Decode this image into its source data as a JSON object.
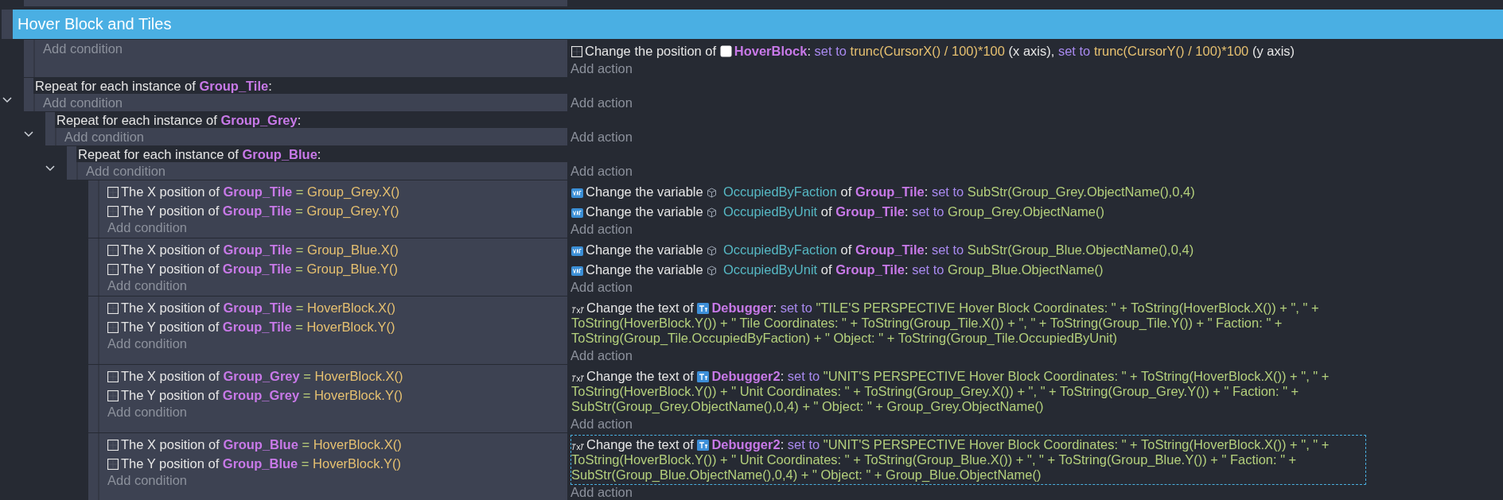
{
  "group": {
    "title": "Hover Block and Tiles"
  },
  "events": [
    {
      "kind": "standard",
      "add_condition": "Add condition",
      "add_action": "Add action",
      "actions": [
        {
          "kind": "position",
          "selected": false,
          "parts": [
            {
              "kind": "text",
              "text": "Change the position of"
            },
            {
              "kind": "sprite_object",
              "text": "HoverBlock"
            },
            {
              "kind": "text",
              "text": ":"
            },
            {
              "kind": "keyword",
              "text": "set to"
            },
            {
              "kind": "number",
              "text": "trunc(CursorX() / 100)*100"
            },
            {
              "kind": "text",
              "text": "(x axis),"
            },
            {
              "kind": "keyword",
              "text": "set to"
            },
            {
              "kind": "number",
              "text": "trunc(CursorY() / 100)*100"
            },
            {
              "kind": "text",
              "text": "(y axis)"
            }
          ]
        }
      ]
    },
    {
      "kind": "repeat",
      "expanded": true,
      "title": [
        {
          "kind": "text",
          "text": "Repeat for each instance of"
        },
        {
          "kind": "object",
          "text": "Group_Tile"
        },
        {
          "kind": "text",
          "text": ":"
        }
      ],
      "add_condition": "Add condition",
      "add_action": "Add action",
      "children": [
        {
          "kind": "repeat",
          "expanded": true,
          "title": [
            {
              "kind": "text",
              "text": "Repeat for each instance of"
            },
            {
              "kind": "object",
              "text": "Group_Grey"
            },
            {
              "kind": "text",
              "text": ":"
            }
          ],
          "add_condition": "Add condition",
          "add_action": "Add action",
          "children": [
            {
              "kind": "repeat",
              "expanded": true,
              "title": [
                {
                  "kind": "text",
                  "text": "Repeat for each instance of"
                },
                {
                  "kind": "object",
                  "text": "Group_Blue"
                },
                {
                  "kind": "text",
                  "text": ":"
                }
              ],
              "add_condition": "Add condition",
              "add_action": "Add action",
              "children": [
                {
                  "kind": "standard",
                  "add_condition": "Add condition",
                  "add_action": "Add action",
                  "conditions": [
                    {
                      "kind": "compare",
                      "parts": [
                        {
                          "kind": "text",
                          "text": "The X position of"
                        },
                        {
                          "kind": "object",
                          "text": "Group_Tile"
                        },
                        {
                          "kind": "operator",
                          "text": "="
                        },
                        {
                          "kind": "number",
                          "text": "Group_Grey.X()"
                        }
                      ]
                    },
                    {
                      "kind": "compare",
                      "parts": [
                        {
                          "kind": "text",
                          "text": "The Y position of"
                        },
                        {
                          "kind": "object",
                          "text": "Group_Tile"
                        },
                        {
                          "kind": "operator",
                          "text": "="
                        },
                        {
                          "kind": "number",
                          "text": "Group_Grey.Y()"
                        }
                      ]
                    }
                  ],
                  "actions": [
                    {
                      "kind": "variable",
                      "selected": false,
                      "parts": [
                        {
                          "kind": "text",
                          "text": "Change the variable"
                        },
                        {
                          "kind": "variable",
                          "text": "OccupiedByFaction"
                        },
                        {
                          "kind": "text",
                          "text": "of"
                        },
                        {
                          "kind": "object",
                          "text": "Group_Tile"
                        },
                        {
                          "kind": "text",
                          "text": ":"
                        },
                        {
                          "kind": "keyword",
                          "text": "set to"
                        },
                        {
                          "kind": "string",
                          "text": "SubStr(Group_Grey.ObjectName(),0,4)"
                        }
                      ]
                    },
                    {
                      "kind": "variable",
                      "selected": false,
                      "parts": [
                        {
                          "kind": "text",
                          "text": "Change the variable"
                        },
                        {
                          "kind": "variable",
                          "text": "OccupiedByUnit"
                        },
                        {
                          "kind": "text",
                          "text": "of"
                        },
                        {
                          "kind": "object",
                          "text": "Group_Tile"
                        },
                        {
                          "kind": "text",
                          "text": ":"
                        },
                        {
                          "kind": "keyword",
                          "text": "set to"
                        },
                        {
                          "kind": "string",
                          "text": "Group_Grey.ObjectName()"
                        }
                      ]
                    }
                  ]
                },
                {
                  "kind": "standard",
                  "add_condition": "Add condition",
                  "add_action": "Add action",
                  "conditions": [
                    {
                      "kind": "compare",
                      "parts": [
                        {
                          "kind": "text",
                          "text": "The X position of"
                        },
                        {
                          "kind": "object",
                          "text": "Group_Tile"
                        },
                        {
                          "kind": "operator",
                          "text": "="
                        },
                        {
                          "kind": "number",
                          "text": "Group_Blue.X()"
                        }
                      ]
                    },
                    {
                      "kind": "compare",
                      "parts": [
                        {
                          "kind": "text",
                          "text": "The Y position of"
                        },
                        {
                          "kind": "object",
                          "text": "Group_Tile"
                        },
                        {
                          "kind": "operator",
                          "text": "="
                        },
                        {
                          "kind": "number",
                          "text": "Group_Blue.Y()"
                        }
                      ]
                    }
                  ],
                  "actions": [
                    {
                      "kind": "variable",
                      "selected": false,
                      "parts": [
                        {
                          "kind": "text",
                          "text": "Change the variable"
                        },
                        {
                          "kind": "variable",
                          "text": "OccupiedByFaction"
                        },
                        {
                          "kind": "text",
                          "text": "of"
                        },
                        {
                          "kind": "object",
                          "text": "Group_Tile"
                        },
                        {
                          "kind": "text",
                          "text": ":"
                        },
                        {
                          "kind": "keyword",
                          "text": "set to"
                        },
                        {
                          "kind": "string",
                          "text": "SubStr(Group_Blue.ObjectName(),0,4)"
                        }
                      ]
                    },
                    {
                      "kind": "variable",
                      "selected": false,
                      "parts": [
                        {
                          "kind": "text",
                          "text": "Change the variable"
                        },
                        {
                          "kind": "variable",
                          "text": "OccupiedByUnit"
                        },
                        {
                          "kind": "text",
                          "text": "of"
                        },
                        {
                          "kind": "object",
                          "text": "Group_Tile"
                        },
                        {
                          "kind": "text",
                          "text": ":"
                        },
                        {
                          "kind": "keyword",
                          "text": "set to"
                        },
                        {
                          "kind": "string",
                          "text": "Group_Blue.ObjectName()"
                        }
                      ]
                    }
                  ]
                },
                {
                  "kind": "standard",
                  "add_condition": "Add condition",
                  "add_action": "Add action",
                  "conditions": [
                    {
                      "kind": "compare",
                      "parts": [
                        {
                          "kind": "text",
                          "text": "The X position of"
                        },
                        {
                          "kind": "object",
                          "text": "Group_Tile"
                        },
                        {
                          "kind": "operator",
                          "text": "="
                        },
                        {
                          "kind": "number",
                          "text": "HoverBlock.X()"
                        }
                      ]
                    },
                    {
                      "kind": "compare",
                      "parts": [
                        {
                          "kind": "text",
                          "text": "The Y position of"
                        },
                        {
                          "kind": "object",
                          "text": "Group_Tile"
                        },
                        {
                          "kind": "operator",
                          "text": "="
                        },
                        {
                          "kind": "number",
                          "text": "HoverBlock.Y()"
                        }
                      ]
                    }
                  ],
                  "actions": [
                    {
                      "kind": "text",
                      "selected": false,
                      "parts": [
                        {
                          "kind": "text",
                          "text": "Change the text of"
                        },
                        {
                          "kind": "text_object",
                          "text": "Debugger"
                        },
                        {
                          "kind": "text",
                          "text": ":"
                        },
                        {
                          "kind": "keyword",
                          "text": "set to"
                        },
                        {
                          "kind": "string",
                          "text": "\"TILE'S PERSPECTIVE Hover Block Coordinates: \" + ToString(HoverBlock.X()) + \", \" + ToString(HoverBlock.Y()) + \" Tile Coordinates: \" + ToString(Group_Tile.X()) + \", \" + ToString(Group_Tile.Y()) + \" Faction: \" + ToString(Group_Tile.OccupiedByFaction) + \" Object: \" + ToString(Group_Tile.OccupiedByUnit)"
                        }
                      ]
                    }
                  ]
                },
                {
                  "kind": "standard",
                  "add_condition": "Add condition",
                  "add_action": "Add action",
                  "conditions": [
                    {
                      "kind": "compare",
                      "parts": [
                        {
                          "kind": "text",
                          "text": "The X position of"
                        },
                        {
                          "kind": "object",
                          "text": "Group_Grey"
                        },
                        {
                          "kind": "operator",
                          "text": "="
                        },
                        {
                          "kind": "number",
                          "text": "HoverBlock.X()"
                        }
                      ]
                    },
                    {
                      "kind": "compare",
                      "parts": [
                        {
                          "kind": "text",
                          "text": "The Y position of"
                        },
                        {
                          "kind": "object",
                          "text": "Group_Grey"
                        },
                        {
                          "kind": "operator",
                          "text": "="
                        },
                        {
                          "kind": "number",
                          "text": "HoverBlock.Y()"
                        }
                      ]
                    }
                  ],
                  "actions": [
                    {
                      "kind": "text",
                      "selected": false,
                      "parts": [
                        {
                          "kind": "text",
                          "text": "Change the text of"
                        },
                        {
                          "kind": "text_object",
                          "text": "Debugger2"
                        },
                        {
                          "kind": "text",
                          "text": ":"
                        },
                        {
                          "kind": "keyword",
                          "text": "set to"
                        },
                        {
                          "kind": "string",
                          "text": "\"UNIT'S PERSPECTIVE Hover Block Coordinates: \" + ToString(HoverBlock.X()) + \", \" + ToString(HoverBlock.Y()) + \" Unit Coordinates: \" + ToString(Group_Grey.X()) + \", \" + ToString(Group_Grey.Y()) + \" Faction: \" + SubStr(Group_Grey.ObjectName(),0,4) + \" Object: \" + Group_Grey.ObjectName()"
                        }
                      ]
                    }
                  ]
                },
                {
                  "kind": "standard",
                  "add_condition": "Add condition",
                  "add_action": "Add action",
                  "conditions": [
                    {
                      "kind": "compare",
                      "parts": [
                        {
                          "kind": "text",
                          "text": "The X position of"
                        },
                        {
                          "kind": "object",
                          "text": "Group_Blue"
                        },
                        {
                          "kind": "operator",
                          "text": "="
                        },
                        {
                          "kind": "number",
                          "text": "HoverBlock.X()"
                        }
                      ]
                    },
                    {
                      "kind": "compare",
                      "parts": [
                        {
                          "kind": "text",
                          "text": "The Y position of"
                        },
                        {
                          "kind": "object",
                          "text": "Group_Blue"
                        },
                        {
                          "kind": "operator",
                          "text": "="
                        },
                        {
                          "kind": "number",
                          "text": "HoverBlock.Y()"
                        }
                      ]
                    }
                  ],
                  "actions": [
                    {
                      "kind": "text",
                      "selected": true,
                      "parts": [
                        {
                          "kind": "text",
                          "text": "Change the text of"
                        },
                        {
                          "kind": "text_object",
                          "text": "Debugger2"
                        },
                        {
                          "kind": "text",
                          "text": ":"
                        },
                        {
                          "kind": "keyword",
                          "text": "set to"
                        },
                        {
                          "kind": "string",
                          "text": "\"UNIT'S PERSPECTIVE Hover Block Coordinates: \" + ToString(HoverBlock.X()) + \", \" + ToString(HoverBlock.Y()) + \" Unit Coordinates: \" + ToString(Group_Blue.X()) + \", \" + ToString(Group_Blue.Y()) + \" Faction: \" + SubStr(Group_Blue.ObjectName(),0,4) + \" Object: \" + Group_Blue.ObjectName()"
                        }
                      ]
                    }
                  ]
                }
              ]
            }
          ]
        }
      ]
    }
  ]
}
